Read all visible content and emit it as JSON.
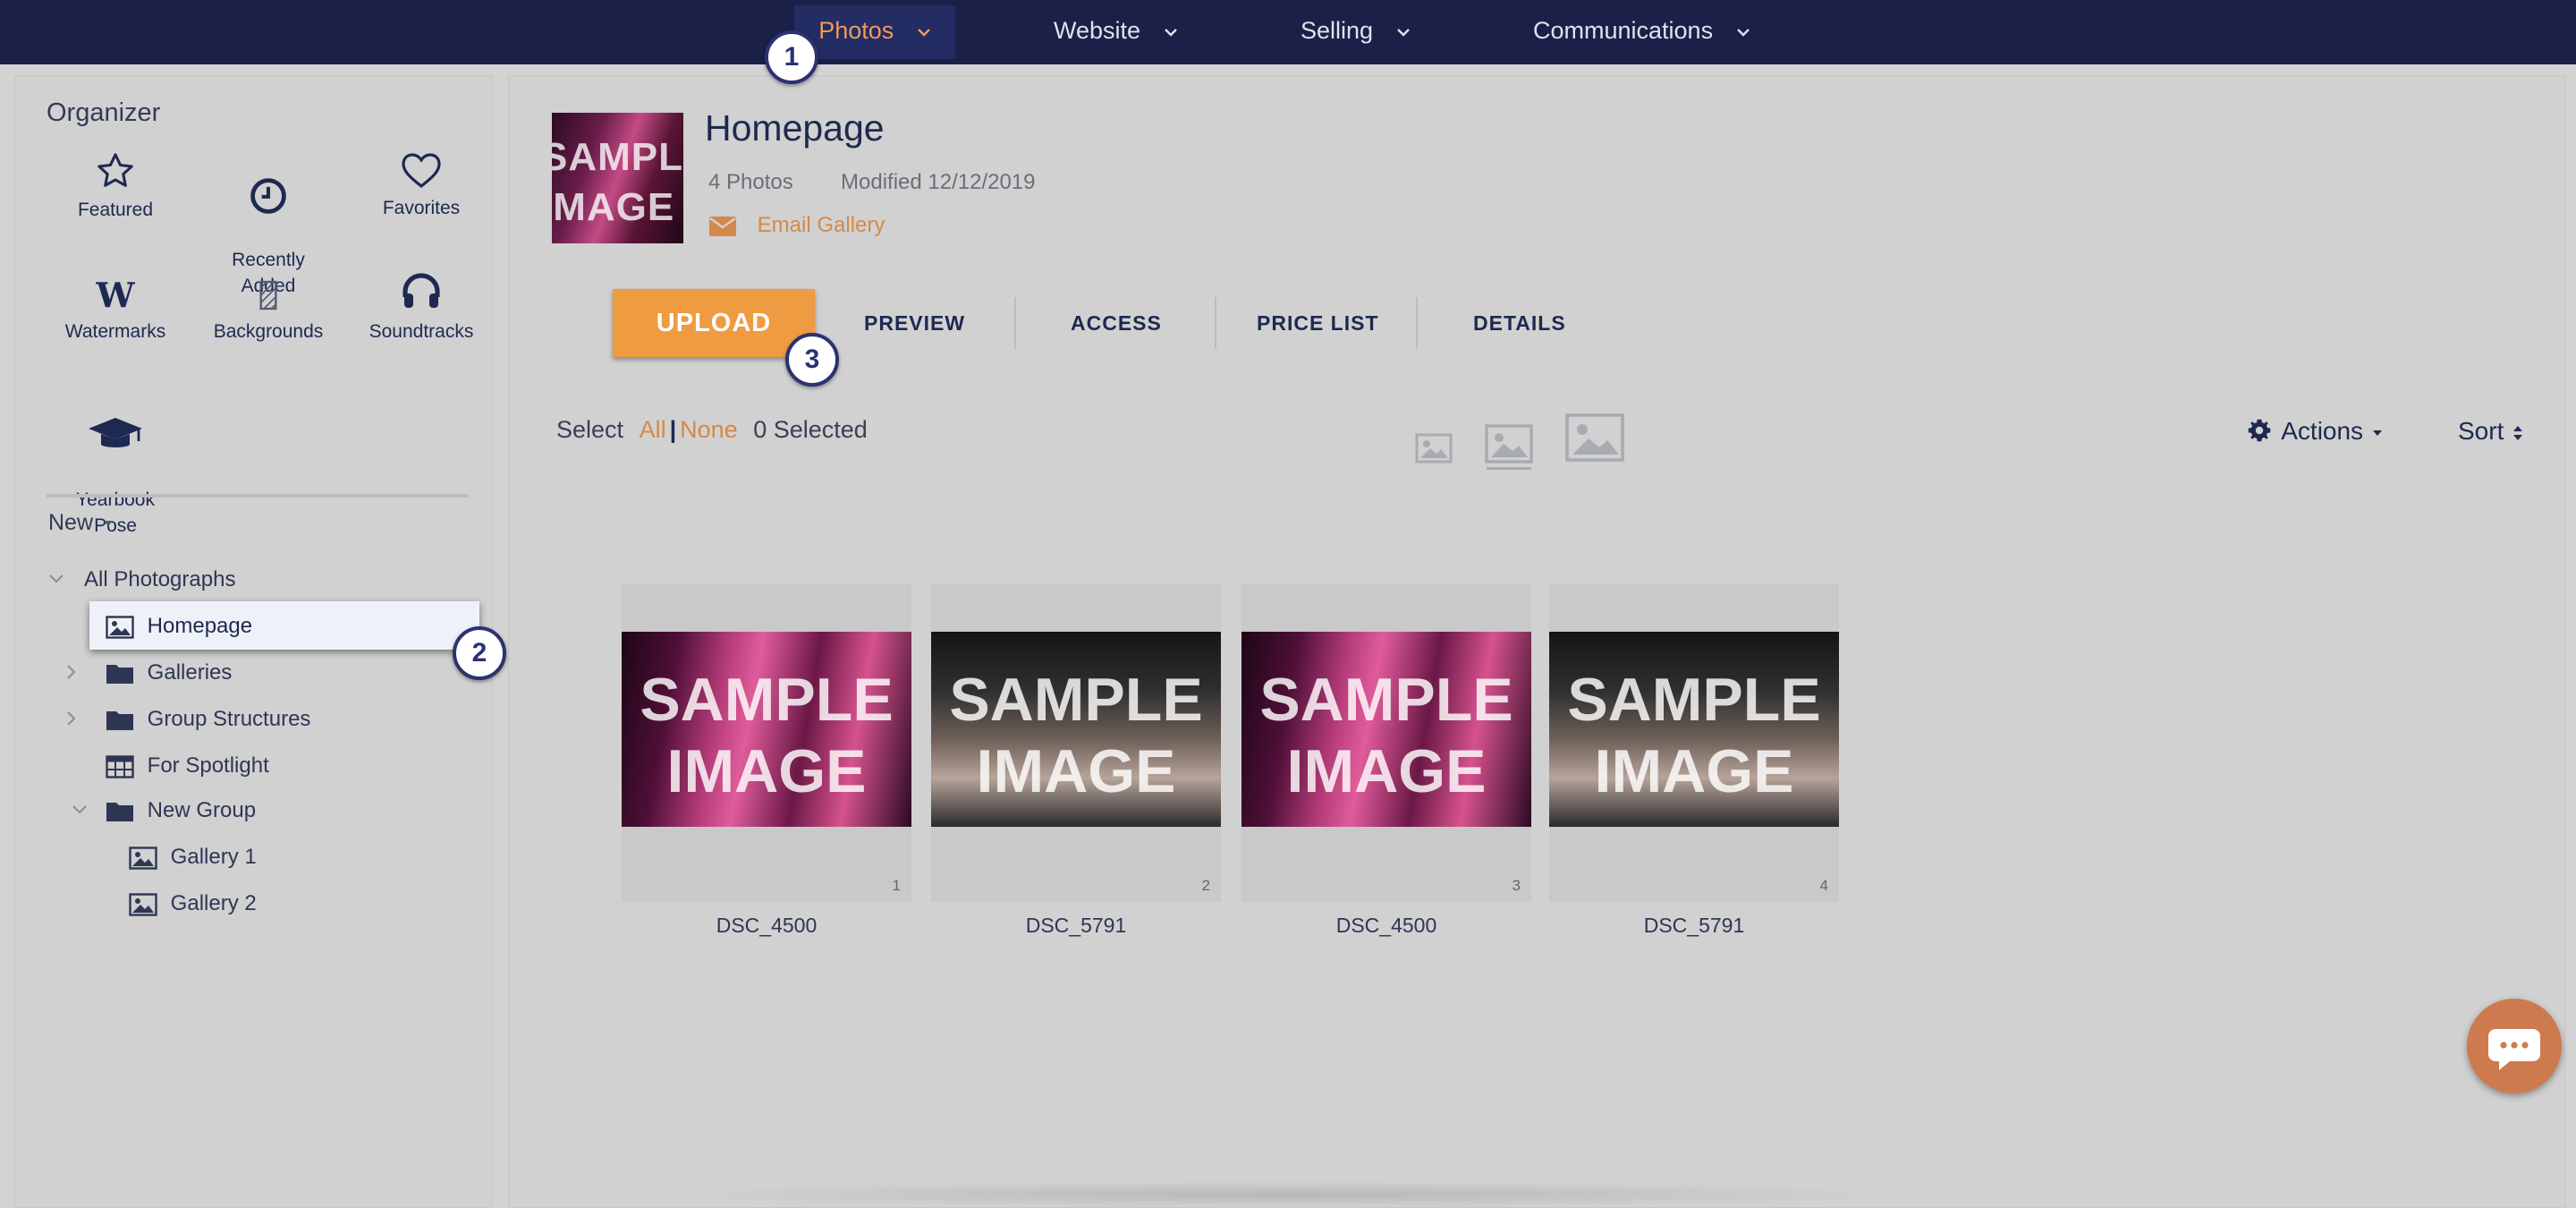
{
  "nav": {
    "items": [
      {
        "label": "Photos"
      },
      {
        "label": "Website"
      },
      {
        "label": "Selling"
      },
      {
        "label": "Communications"
      }
    ]
  },
  "organizer": {
    "title": "Organizer",
    "items": [
      {
        "label": "Featured",
        "icon": "star-icon"
      },
      {
        "label": "Recently\nAdded",
        "icon": "clock-icon"
      },
      {
        "label": "Favorites",
        "icon": "heart-icon"
      },
      {
        "label": "Watermarks",
        "icon": "watermark-icon"
      },
      {
        "label": "Backgrounds",
        "icon": "background-icon"
      },
      {
        "label": "Soundtracks",
        "icon": "headphones-icon"
      },
      {
        "label": "Yearbook\nPose",
        "icon": "graduation-cap-icon"
      }
    ],
    "new_label": "New"
  },
  "tree": {
    "items": [
      {
        "label": "All Photographs",
        "icon": "none"
      },
      {
        "label": "Homepage",
        "icon": "gallery-icon"
      },
      {
        "label": "Galleries",
        "icon": "folder-icon"
      },
      {
        "label": "Group Structures",
        "icon": "folder-icon"
      },
      {
        "label": "For Spotlight",
        "icon": "table-icon"
      },
      {
        "label": "New Group",
        "icon": "folder-icon"
      },
      {
        "label": "Gallery 1",
        "icon": "gallery-icon"
      },
      {
        "label": "Gallery 2",
        "icon": "gallery-icon"
      }
    ]
  },
  "gallery": {
    "title": "Homepage",
    "photo_count": "4 Photos",
    "modified": "Modified 12/12/2019",
    "email_label": "Email Gallery",
    "cover_text": "SAMPLE\nIMAGE"
  },
  "tabs": {
    "upload": "UPLOAD",
    "items": [
      "PREVIEW",
      "ACCESS",
      "PRICE LIST",
      "DETAILS"
    ]
  },
  "selection": {
    "select_label": "Select",
    "all_label": "All",
    "separator": "|",
    "none_label": "None",
    "selected_count": "0 Selected"
  },
  "toolbar": {
    "actions_label": "Actions",
    "sort_label": "Sort"
  },
  "photos": [
    {
      "name": "DSC_4500",
      "index": "1",
      "watermark": "SAMPLE\nIMAGE"
    },
    {
      "name": "DSC_5791",
      "index": "2",
      "watermark": "SAMPLE\nIMAGE"
    },
    {
      "name": "DSC_4500",
      "index": "3",
      "watermark": "SAMPLE\nIMAGE"
    },
    {
      "name": "DSC_5791",
      "index": "4",
      "watermark": "SAMPLE\nIMAGE"
    }
  ],
  "badges": [
    "1",
    "2",
    "3"
  ],
  "colors": {
    "nav_bg": "#1b2049",
    "accent": "#ef9b41",
    "link": "#d38a48",
    "text": "#1d2950"
  }
}
